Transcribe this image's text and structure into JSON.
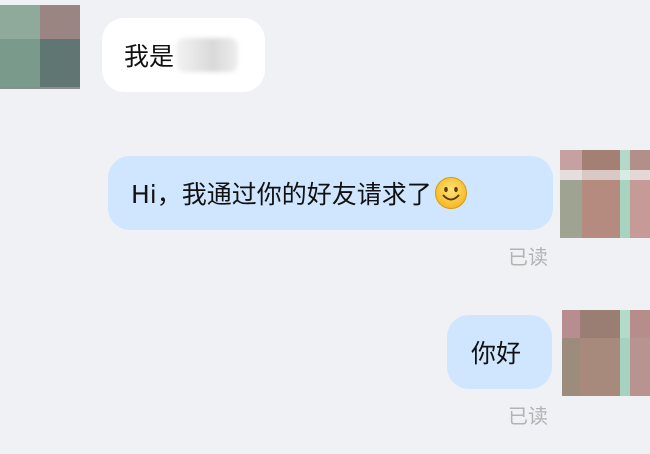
{
  "messages": [
    {
      "direction": "received",
      "text": "我是",
      "redacted": true
    },
    {
      "direction": "sent",
      "text": "Hi，我通过你的好友请求了",
      "emoji": "smile-icon",
      "status": "已读"
    },
    {
      "direction": "sent",
      "text": "你好",
      "status": "已读"
    }
  ],
  "colors": {
    "background": "#f0f1f5",
    "received_bubble": "#ffffff",
    "sent_bubble": "#cfe6fe",
    "read_receipt": "#b3b3b3"
  }
}
